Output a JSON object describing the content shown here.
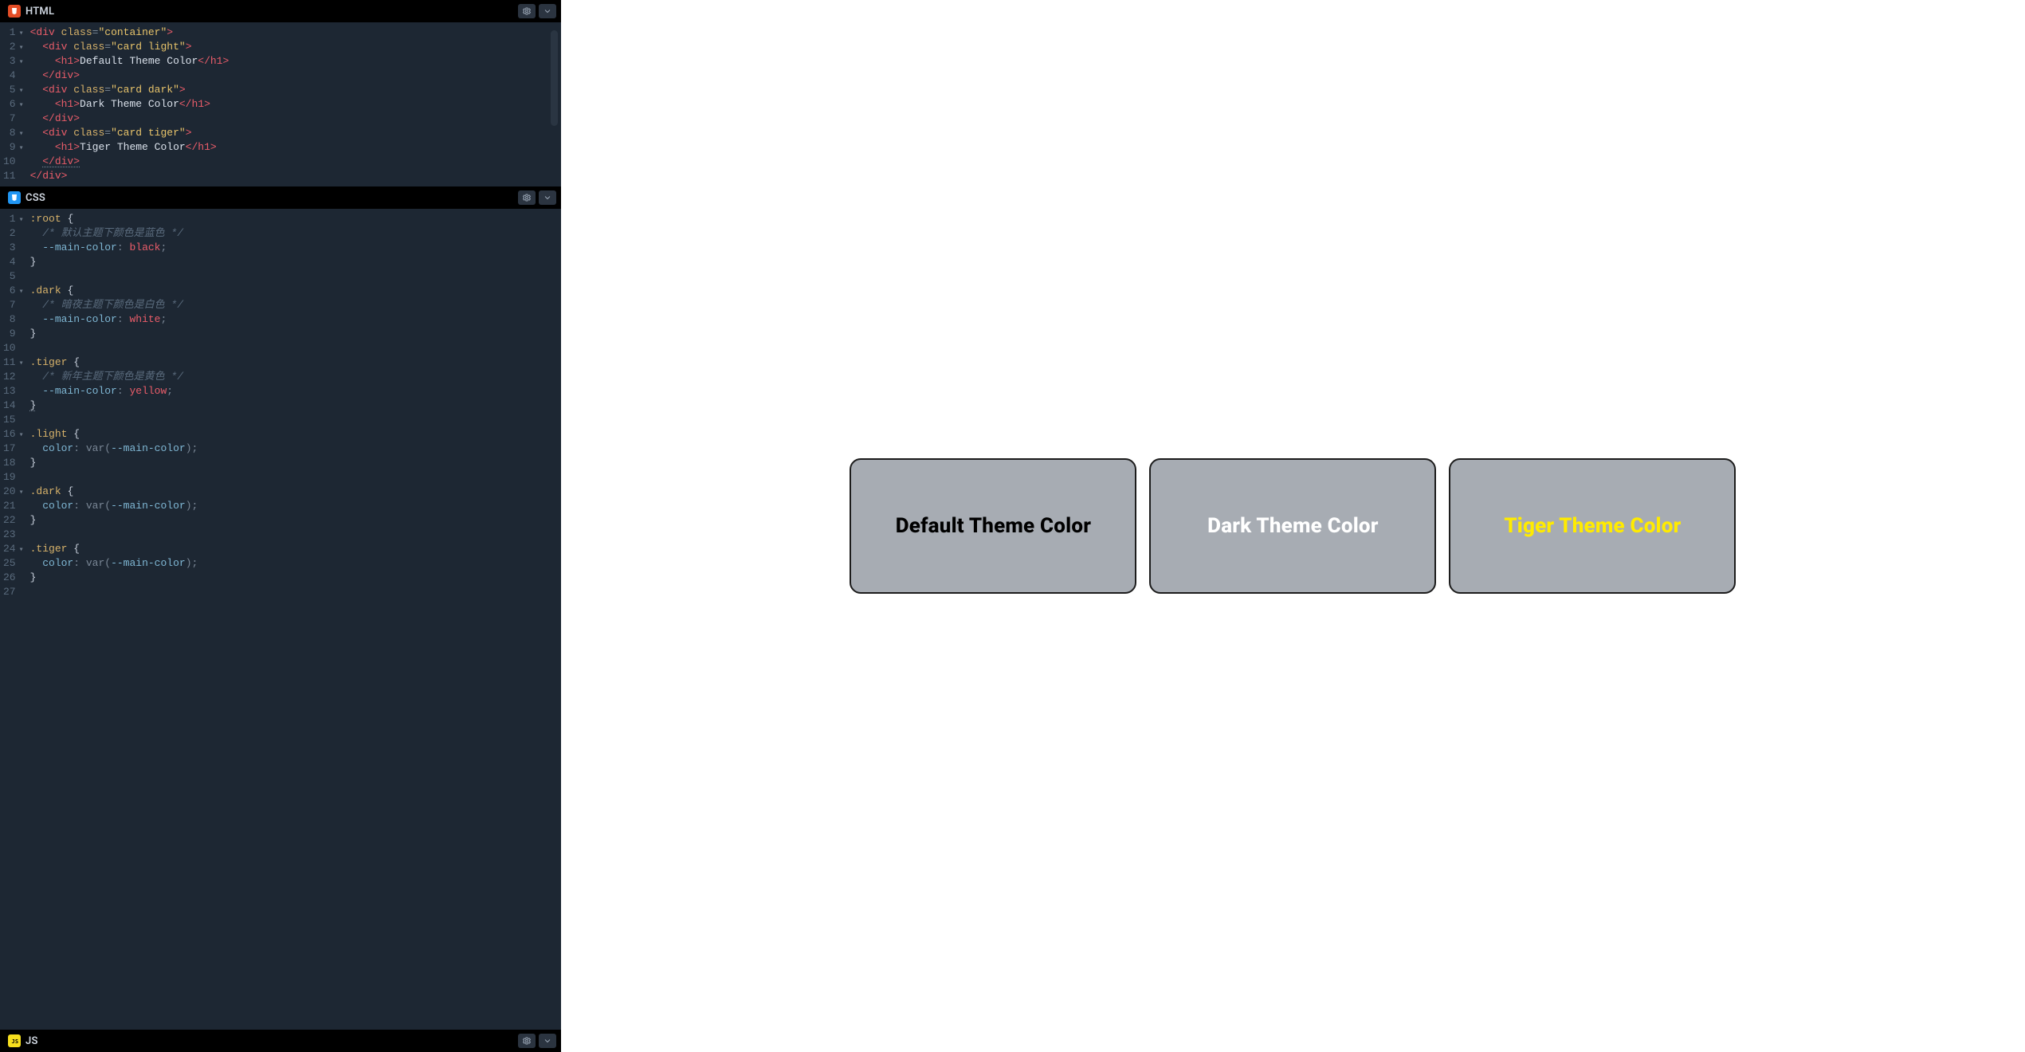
{
  "panels": {
    "html": {
      "title": "HTML"
    },
    "css": {
      "title": "CSS"
    },
    "js": {
      "title": "JS"
    }
  },
  "preview": {
    "cards": [
      {
        "kind": "light",
        "heading": "Default Theme Color"
      },
      {
        "kind": "dark",
        "heading": "Dark Theme Color"
      },
      {
        "kind": "tiger",
        "heading": "Tiger Theme Color"
      }
    ]
  },
  "code": {
    "html": [
      [
        {
          "t": "tag",
          "v": "<div"
        },
        {
          "t": "txt",
          "v": " "
        },
        {
          "t": "attr",
          "v": "class"
        },
        {
          "t": "punc",
          "v": "="
        },
        {
          "t": "str",
          "v": "\"container\""
        },
        {
          "t": "tag",
          "v": ">"
        }
      ],
      [
        {
          "t": "txt",
          "v": "  "
        },
        {
          "t": "tag",
          "v": "<div"
        },
        {
          "t": "txt",
          "v": " "
        },
        {
          "t": "attr",
          "v": "class"
        },
        {
          "t": "punc",
          "v": "="
        },
        {
          "t": "str",
          "v": "\"card light\""
        },
        {
          "t": "tag",
          "v": ">"
        }
      ],
      [
        {
          "t": "txt",
          "v": "    "
        },
        {
          "t": "tag",
          "v": "<h1>"
        },
        {
          "t": "txt",
          "v": "Default Theme Color"
        },
        {
          "t": "tag",
          "v": "</h1>"
        }
      ],
      [
        {
          "t": "txt",
          "v": "  "
        },
        {
          "t": "tag",
          "v": "</div>"
        }
      ],
      [
        {
          "t": "txt",
          "v": "  "
        },
        {
          "t": "tag",
          "v": "<div"
        },
        {
          "t": "txt",
          "v": " "
        },
        {
          "t": "attr",
          "v": "class"
        },
        {
          "t": "punc",
          "v": "="
        },
        {
          "t": "str",
          "v": "\"card dark\""
        },
        {
          "t": "tag",
          "v": ">"
        }
      ],
      [
        {
          "t": "txt",
          "v": "    "
        },
        {
          "t": "tag",
          "v": "<h1>"
        },
        {
          "t": "txt",
          "v": "Dark Theme Color"
        },
        {
          "t": "tag",
          "v": "</h1>"
        }
      ],
      [
        {
          "t": "txt",
          "v": "  "
        },
        {
          "t": "tag",
          "v": "</div>"
        }
      ],
      [
        {
          "t": "txt",
          "v": "  "
        },
        {
          "t": "tag",
          "v": "<div"
        },
        {
          "t": "txt",
          "v": " "
        },
        {
          "t": "attr",
          "v": "class"
        },
        {
          "t": "punc",
          "v": "="
        },
        {
          "t": "str",
          "v": "\"card tiger\""
        },
        {
          "t": "tag",
          "v": ">"
        }
      ],
      [
        {
          "t": "txt",
          "v": "    "
        },
        {
          "t": "tag",
          "v": "<h1>"
        },
        {
          "t": "txt",
          "v": "Tiger Theme Color"
        },
        {
          "t": "tag",
          "v": "</h1>"
        }
      ],
      [
        {
          "t": "txt",
          "v": "  "
        },
        {
          "t": "tag",
          "v": "</div>",
          "u": true
        }
      ],
      [
        {
          "t": "tag",
          "v": "</div>"
        }
      ]
    ],
    "css": [
      [
        {
          "t": "sel",
          "v": ":root"
        },
        {
          "t": "txt",
          "v": " "
        },
        {
          "t": "brace",
          "v": "{"
        }
      ],
      [
        {
          "t": "txt",
          "v": "  "
        },
        {
          "t": "cmnt",
          "v": "/* 默认主题下颜色是蓝色 */"
        }
      ],
      [
        {
          "t": "txt",
          "v": "  "
        },
        {
          "t": "prop",
          "v": "--main-color"
        },
        {
          "t": "punc",
          "v": ":"
        },
        {
          "t": "txt",
          "v": " "
        },
        {
          "t": "val",
          "v": "black"
        },
        {
          "t": "punc",
          "v": ";"
        }
      ],
      [
        {
          "t": "brace",
          "v": "}"
        }
      ],
      [],
      [
        {
          "t": "sel",
          "v": ".dark"
        },
        {
          "t": "txt",
          "v": " "
        },
        {
          "t": "brace",
          "v": "{"
        }
      ],
      [
        {
          "t": "txt",
          "v": "  "
        },
        {
          "t": "cmnt",
          "v": "/* 暗夜主题下颜色是白色 */"
        }
      ],
      [
        {
          "t": "txt",
          "v": "  "
        },
        {
          "t": "prop",
          "v": "--main-color"
        },
        {
          "t": "punc",
          "v": ":"
        },
        {
          "t": "txt",
          "v": " "
        },
        {
          "t": "val",
          "v": "white"
        },
        {
          "t": "punc",
          "v": ";"
        }
      ],
      [
        {
          "t": "brace",
          "v": "}"
        }
      ],
      [],
      [
        {
          "t": "sel",
          "v": ".tiger"
        },
        {
          "t": "txt",
          "v": " "
        },
        {
          "t": "brace",
          "v": "{"
        }
      ],
      [
        {
          "t": "txt",
          "v": "  "
        },
        {
          "t": "cmnt",
          "v": "/* 新年主题下颜色是黄色 */"
        }
      ],
      [
        {
          "t": "txt",
          "v": "  "
        },
        {
          "t": "prop",
          "v": "--main-color"
        },
        {
          "t": "punc",
          "v": ":"
        },
        {
          "t": "txt",
          "v": " "
        },
        {
          "t": "val",
          "v": "yellow"
        },
        {
          "t": "punc",
          "v": ";"
        }
      ],
      [
        {
          "t": "brace",
          "v": "}",
          "u": true
        }
      ],
      [],
      [
        {
          "t": "sel",
          "v": ".light"
        },
        {
          "t": "txt",
          "v": " "
        },
        {
          "t": "brace",
          "v": "{"
        }
      ],
      [
        {
          "t": "txt",
          "v": "  "
        },
        {
          "t": "prop",
          "v": "color"
        },
        {
          "t": "punc",
          "v": ":"
        },
        {
          "t": "txt",
          "v": " "
        },
        {
          "t": "var",
          "v": "var"
        },
        {
          "t": "punc",
          "v": "("
        },
        {
          "t": "prop",
          "v": "--main-color"
        },
        {
          "t": "punc",
          "v": ")"
        },
        {
          "t": "punc",
          "v": ";"
        }
      ],
      [
        {
          "t": "brace",
          "v": "}"
        }
      ],
      [],
      [
        {
          "t": "sel",
          "v": ".dark"
        },
        {
          "t": "txt",
          "v": " "
        },
        {
          "t": "brace",
          "v": "{"
        }
      ],
      [
        {
          "t": "txt",
          "v": "  "
        },
        {
          "t": "prop",
          "v": "color"
        },
        {
          "t": "punc",
          "v": ":"
        },
        {
          "t": "txt",
          "v": " "
        },
        {
          "t": "var",
          "v": "var"
        },
        {
          "t": "punc",
          "v": "("
        },
        {
          "t": "prop",
          "v": "--main-color"
        },
        {
          "t": "punc",
          "v": ")"
        },
        {
          "t": "punc",
          "v": ";"
        }
      ],
      [
        {
          "t": "brace",
          "v": "}"
        }
      ],
      [],
      [
        {
          "t": "sel",
          "v": ".tiger"
        },
        {
          "t": "txt",
          "v": " "
        },
        {
          "t": "brace",
          "v": "{"
        }
      ],
      [
        {
          "t": "txt",
          "v": "  "
        },
        {
          "t": "prop",
          "v": "color"
        },
        {
          "t": "punc",
          "v": ":"
        },
        {
          "t": "txt",
          "v": " "
        },
        {
          "t": "var",
          "v": "var"
        },
        {
          "t": "punc",
          "v": "("
        },
        {
          "t": "prop",
          "v": "--main-color"
        },
        {
          "t": "punc",
          "v": ")"
        },
        {
          "t": "punc",
          "v": ";"
        }
      ],
      [
        {
          "t": "brace",
          "v": "}"
        }
      ],
      []
    ],
    "htmlFoldRows": [
      1,
      2,
      3,
      5,
      6,
      8,
      9
    ]
  }
}
